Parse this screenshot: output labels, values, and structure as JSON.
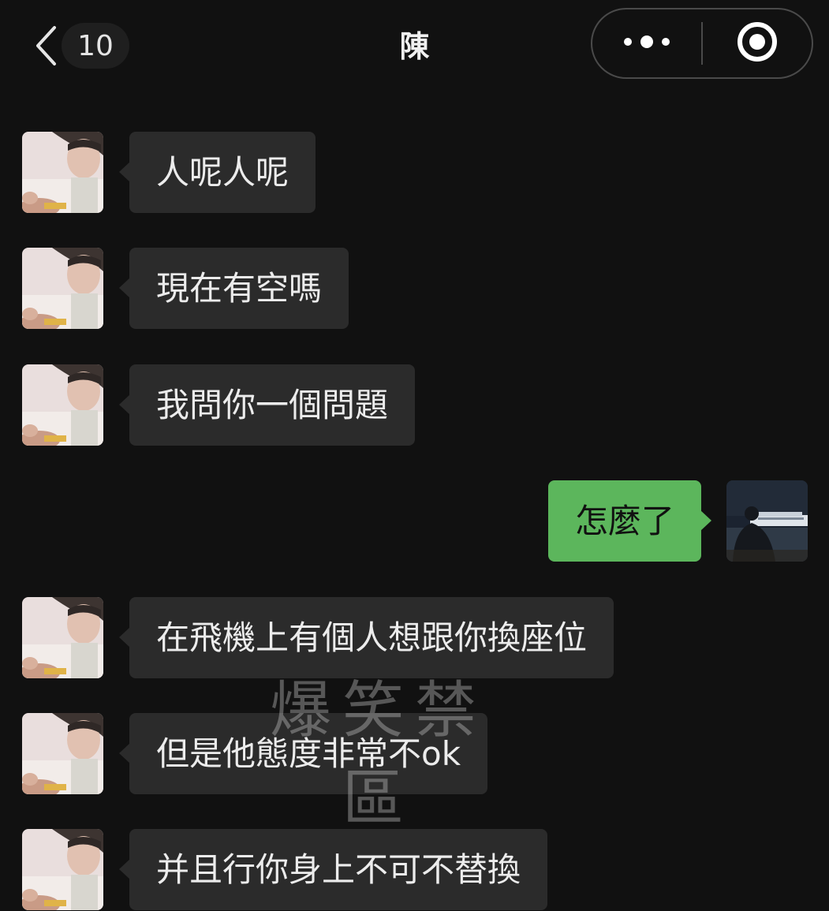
{
  "header": {
    "back_icon": "chevron-left-icon",
    "unread_count": "10",
    "title": "陳",
    "more_icon": "more-dots-icon",
    "close_icon": "target-close-icon"
  },
  "colors": {
    "background": "#111111",
    "incoming_bubble": "#2b2b2b",
    "outgoing_bubble": "#5cb65c"
  },
  "messages": [
    {
      "side": "incoming",
      "text": "人呢人呢"
    },
    {
      "side": "incoming",
      "text": "現在有空嗎"
    },
    {
      "side": "incoming",
      "text": "我問你一個問題"
    },
    {
      "side": "outgoing",
      "text": "怎麼了"
    },
    {
      "side": "incoming",
      "text": "在飛機上有個人想跟你換座位"
    },
    {
      "side": "incoming",
      "text": "但是他態度非常不ok"
    },
    {
      "side": "incoming",
      "text": "并且行你身上不可不替換"
    }
  ],
  "watermark": "爆笑禁區"
}
